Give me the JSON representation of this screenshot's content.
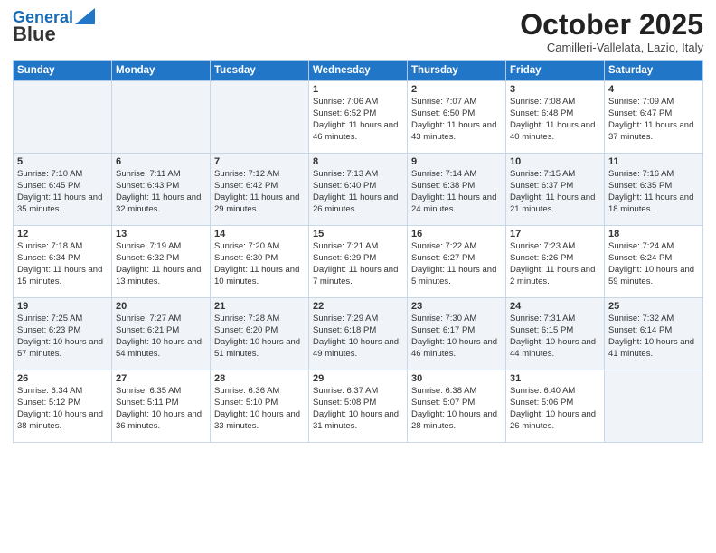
{
  "header": {
    "logo_line1": "General",
    "logo_line2": "Blue",
    "month_title": "October 2025",
    "subtitle": "Camilleri-Vallelata, Lazio, Italy"
  },
  "days_of_week": [
    "Sunday",
    "Monday",
    "Tuesday",
    "Wednesday",
    "Thursday",
    "Friday",
    "Saturday"
  ],
  "weeks": [
    [
      {
        "day": "",
        "info": ""
      },
      {
        "day": "",
        "info": ""
      },
      {
        "day": "",
        "info": ""
      },
      {
        "day": "1",
        "info": "Sunrise: 7:06 AM\nSunset: 6:52 PM\nDaylight: 11 hours and 46 minutes."
      },
      {
        "day": "2",
        "info": "Sunrise: 7:07 AM\nSunset: 6:50 PM\nDaylight: 11 hours and 43 minutes."
      },
      {
        "day": "3",
        "info": "Sunrise: 7:08 AM\nSunset: 6:48 PM\nDaylight: 11 hours and 40 minutes."
      },
      {
        "day": "4",
        "info": "Sunrise: 7:09 AM\nSunset: 6:47 PM\nDaylight: 11 hours and 37 minutes."
      }
    ],
    [
      {
        "day": "5",
        "info": "Sunrise: 7:10 AM\nSunset: 6:45 PM\nDaylight: 11 hours and 35 minutes."
      },
      {
        "day": "6",
        "info": "Sunrise: 7:11 AM\nSunset: 6:43 PM\nDaylight: 11 hours and 32 minutes."
      },
      {
        "day": "7",
        "info": "Sunrise: 7:12 AM\nSunset: 6:42 PM\nDaylight: 11 hours and 29 minutes."
      },
      {
        "day": "8",
        "info": "Sunrise: 7:13 AM\nSunset: 6:40 PM\nDaylight: 11 hours and 26 minutes."
      },
      {
        "day": "9",
        "info": "Sunrise: 7:14 AM\nSunset: 6:38 PM\nDaylight: 11 hours and 24 minutes."
      },
      {
        "day": "10",
        "info": "Sunrise: 7:15 AM\nSunset: 6:37 PM\nDaylight: 11 hours and 21 minutes."
      },
      {
        "day": "11",
        "info": "Sunrise: 7:16 AM\nSunset: 6:35 PM\nDaylight: 11 hours and 18 minutes."
      }
    ],
    [
      {
        "day": "12",
        "info": "Sunrise: 7:18 AM\nSunset: 6:34 PM\nDaylight: 11 hours and 15 minutes."
      },
      {
        "day": "13",
        "info": "Sunrise: 7:19 AM\nSunset: 6:32 PM\nDaylight: 11 hours and 13 minutes."
      },
      {
        "day": "14",
        "info": "Sunrise: 7:20 AM\nSunset: 6:30 PM\nDaylight: 11 hours and 10 minutes."
      },
      {
        "day": "15",
        "info": "Sunrise: 7:21 AM\nSunset: 6:29 PM\nDaylight: 11 hours and 7 minutes."
      },
      {
        "day": "16",
        "info": "Sunrise: 7:22 AM\nSunset: 6:27 PM\nDaylight: 11 hours and 5 minutes."
      },
      {
        "day": "17",
        "info": "Sunrise: 7:23 AM\nSunset: 6:26 PM\nDaylight: 11 hours and 2 minutes."
      },
      {
        "day": "18",
        "info": "Sunrise: 7:24 AM\nSunset: 6:24 PM\nDaylight: 10 hours and 59 minutes."
      }
    ],
    [
      {
        "day": "19",
        "info": "Sunrise: 7:25 AM\nSunset: 6:23 PM\nDaylight: 10 hours and 57 minutes."
      },
      {
        "day": "20",
        "info": "Sunrise: 7:27 AM\nSunset: 6:21 PM\nDaylight: 10 hours and 54 minutes."
      },
      {
        "day": "21",
        "info": "Sunrise: 7:28 AM\nSunset: 6:20 PM\nDaylight: 10 hours and 51 minutes."
      },
      {
        "day": "22",
        "info": "Sunrise: 7:29 AM\nSunset: 6:18 PM\nDaylight: 10 hours and 49 minutes."
      },
      {
        "day": "23",
        "info": "Sunrise: 7:30 AM\nSunset: 6:17 PM\nDaylight: 10 hours and 46 minutes."
      },
      {
        "day": "24",
        "info": "Sunrise: 7:31 AM\nSunset: 6:15 PM\nDaylight: 10 hours and 44 minutes."
      },
      {
        "day": "25",
        "info": "Sunrise: 7:32 AM\nSunset: 6:14 PM\nDaylight: 10 hours and 41 minutes."
      }
    ],
    [
      {
        "day": "26",
        "info": "Sunrise: 6:34 AM\nSunset: 5:12 PM\nDaylight: 10 hours and 38 minutes."
      },
      {
        "day": "27",
        "info": "Sunrise: 6:35 AM\nSunset: 5:11 PM\nDaylight: 10 hours and 36 minutes."
      },
      {
        "day": "28",
        "info": "Sunrise: 6:36 AM\nSunset: 5:10 PM\nDaylight: 10 hours and 33 minutes."
      },
      {
        "day": "29",
        "info": "Sunrise: 6:37 AM\nSunset: 5:08 PM\nDaylight: 10 hours and 31 minutes."
      },
      {
        "day": "30",
        "info": "Sunrise: 6:38 AM\nSunset: 5:07 PM\nDaylight: 10 hours and 28 minutes."
      },
      {
        "day": "31",
        "info": "Sunrise: 6:40 AM\nSunset: 5:06 PM\nDaylight: 10 hours and 26 minutes."
      },
      {
        "day": "",
        "info": ""
      }
    ]
  ]
}
